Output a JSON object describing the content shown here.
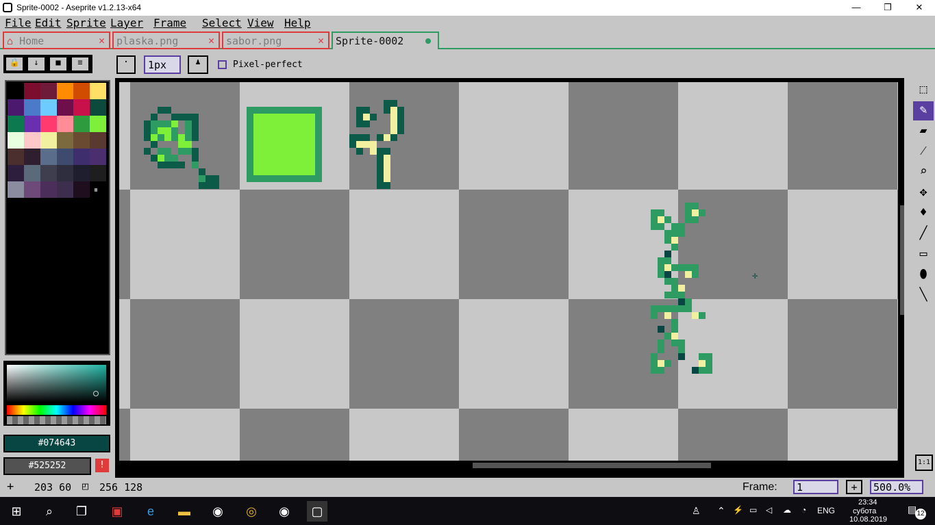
{
  "window": {
    "title": "Sprite-0002 - Aseprite v1.2.13-x64",
    "min": "—",
    "max": "❐",
    "close": "✕"
  },
  "menu": [
    "File",
    "Edit",
    "Sprite",
    "Layer",
    "Frame",
    "Select",
    "View",
    "Help"
  ],
  "tabs": [
    {
      "label": "Home",
      "close": "✕"
    },
    {
      "label": "plaska.png",
      "close": "✕"
    },
    {
      "label": "sabor.png",
      "close": "✕"
    },
    {
      "label": "Sprite-0002"
    }
  ],
  "toolbar": {
    "brush_type": "·",
    "brush_size": "1px",
    "pixel_perfect_label": "Pixel-perfect"
  },
  "palette_colors": [
    "#000000",
    "#7b0e2e",
    "#6e1a39",
    "#ff8c00",
    "#d14c00",
    "#ffe066",
    "#4b1a6e",
    "#4b7ac8",
    "#6ecbff",
    "#6e0e4b",
    "#c8104b",
    "#0c4a3e",
    "#0c7a4e",
    "#6a2fae",
    "#ff3a6e",
    "#ff8c96",
    "#2d9b3e",
    "#7ef03a",
    "#e8ffe0",
    "#ffc8c8",
    "#f0f0a0",
    "#7a6a3e",
    "#6a4a30",
    "#5a3a30",
    "#4b2e2e",
    "#2e1e2e",
    "#5a6e8c",
    "#3e4a6e",
    "#3e2e6e",
    "#4b2e6e",
    "#2e1e3e",
    "#5a6a7a",
    "#3e3e4e",
    "#2e2e3e",
    "#1e1e2e",
    "#1e1e1e",
    "#8c8ca0",
    "#6e4a7a",
    "#4b2e5a",
    "#3e2e4e",
    "#1e0e1e"
  ],
  "foreground_color": "#074643",
  "background_color": "#525252",
  "status": {
    "pos": "203 60",
    "size": "256 128",
    "frame_label": "Frame:",
    "frame_value": "1",
    "plus": "+",
    "zoom": "500.0%"
  },
  "taskbar": {
    "time": "23:34",
    "day": "субота",
    "date": "10.08.2019",
    "lang": "ENG",
    "notif": "12"
  }
}
